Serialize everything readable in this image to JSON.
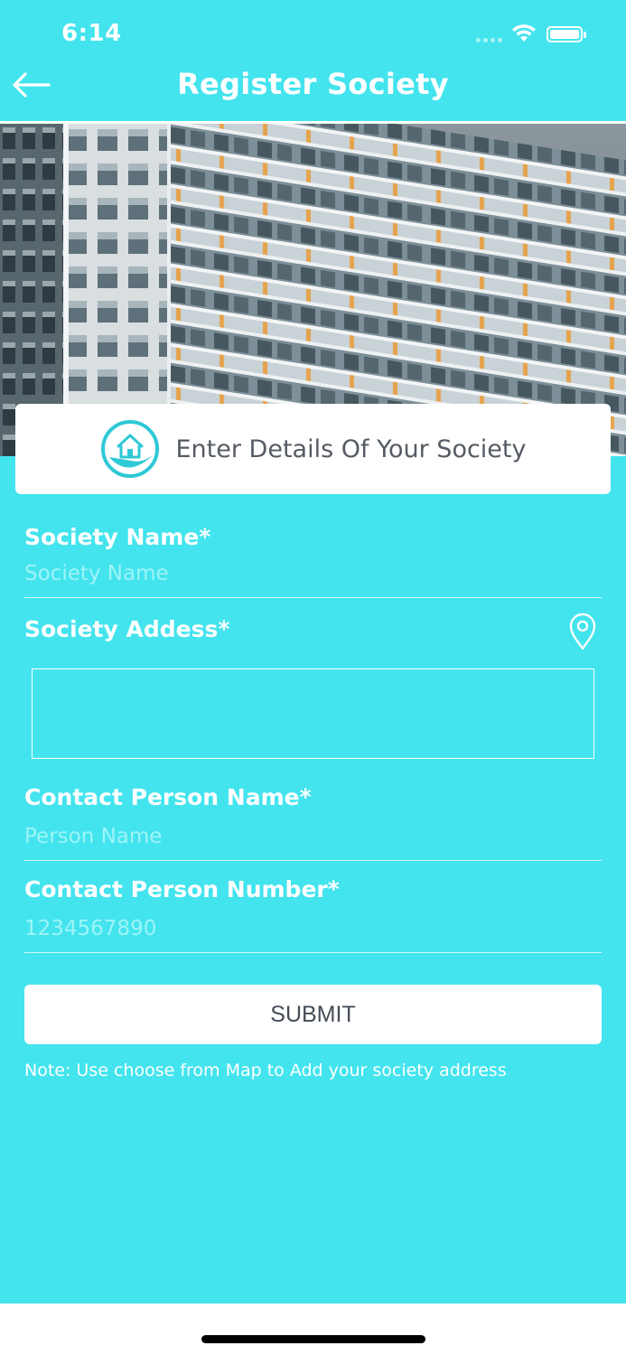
{
  "status_bar": {
    "time": "6:14"
  },
  "nav": {
    "title": "Register Society"
  },
  "card": {
    "title": "Enter Details Of Your Society"
  },
  "form": {
    "society_name": {
      "label": "Society Name*",
      "placeholder": "Society Name",
      "value": ""
    },
    "society_address": {
      "label": "Society Addess*",
      "value": ""
    },
    "contact_name": {
      "label": "Contact Person Name*",
      "placeholder": "Person Name",
      "value": ""
    },
    "contact_number": {
      "label": "Contact Person Number*",
      "placeholder": "1234567890",
      "value": ""
    }
  },
  "submit_label": "SUBMIT",
  "note": "Note: Use choose from Map to Add your society address",
  "icons": {
    "back": "arrow-left-icon",
    "location": "map-pin-icon",
    "logo": "house-in-hand-icon",
    "wifi": "wifi-icon",
    "battery": "battery-icon"
  },
  "colors": {
    "background": "#43e4ee",
    "card_text": "#555b63",
    "placeholder": "#9ef4f7",
    "logo": "#2fc9d6"
  }
}
